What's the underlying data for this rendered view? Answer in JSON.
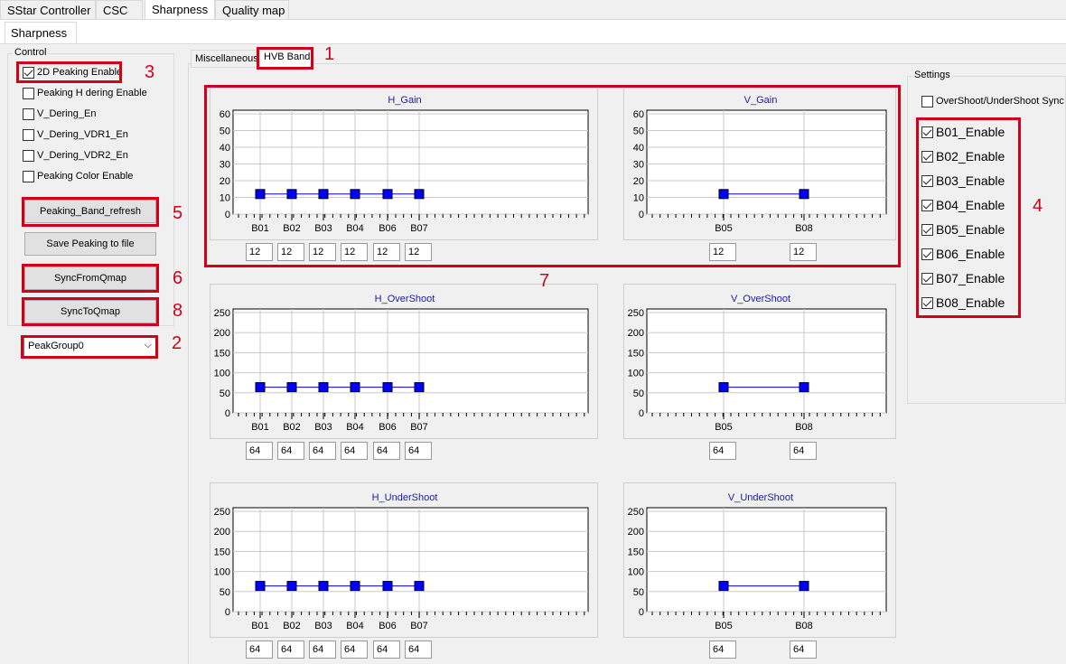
{
  "main_tabs": [
    "SStar Controller",
    "CSC",
    "Sharpness",
    "Quality map"
  ],
  "sub_tab": "Sharpness",
  "control": {
    "label": "Control",
    "checkboxes": [
      {
        "label": "2D Peaking Enable",
        "checked": true
      },
      {
        "label": "Peaking H dering Enable",
        "checked": false
      },
      {
        "label": "V_Dering_En",
        "checked": false
      },
      {
        "label": "V_Dering_VDR1_En",
        "checked": false
      },
      {
        "label": "V_Dering_VDR2_En",
        "checked": false
      },
      {
        "label": "Peaking Color Enable",
        "checked": false
      }
    ],
    "buttons": [
      "Peaking_Band_refresh",
      "Save Peaking to file",
      "SyncFromQmap",
      "SyncToQmap"
    ],
    "peak_group": "PeakGroup0"
  },
  "inner_tabs": [
    "Miscellaneous",
    "HVB Band"
  ],
  "settings": {
    "label": "Settings",
    "sync_label": "OverShoot/UnderShoot Sync",
    "bands": [
      {
        "label": "B01_Enable",
        "checked": true
      },
      {
        "label": "B02_Enable",
        "checked": true
      },
      {
        "label": "B03_Enable",
        "checked": true
      },
      {
        "label": "B04_Enable",
        "checked": true
      },
      {
        "label": "B05_Enable",
        "checked": true
      },
      {
        "label": "B06_Enable",
        "checked": true
      },
      {
        "label": "B07_Enable",
        "checked": true
      },
      {
        "label": "B08_Enable",
        "checked": true
      }
    ]
  },
  "annotations": [
    "1",
    "2",
    "3",
    "4",
    "5",
    "6",
    "7",
    "8"
  ],
  "chart_data": [
    {
      "type": "line",
      "title": "H_Gain",
      "categories": [
        "B01",
        "B02",
        "B03",
        "B04",
        "B06",
        "B07"
      ],
      "values": [
        12,
        12,
        12,
        12,
        12,
        12
      ],
      "ylim": [
        0,
        60
      ],
      "yticks": [
        "0",
        "10",
        "20",
        "30",
        "40",
        "50",
        "60"
      ]
    },
    {
      "type": "line",
      "title": "V_Gain",
      "categories": [
        "B05",
        "B08"
      ],
      "values": [
        12,
        12
      ],
      "ylim": [
        0,
        60
      ],
      "yticks": [
        "0",
        "10",
        "20",
        "30",
        "40",
        "50",
        "60"
      ]
    },
    {
      "type": "line",
      "title": "H_OverShoot",
      "categories": [
        "B01",
        "B02",
        "B03",
        "B04",
        "B06",
        "B07"
      ],
      "values": [
        64,
        64,
        64,
        64,
        64,
        64
      ],
      "ylim": [
        0,
        250
      ],
      "yticks": [
        "0",
        "50",
        "100",
        "150",
        "200",
        "250"
      ]
    },
    {
      "type": "line",
      "title": "V_OverShoot",
      "categories": [
        "B05",
        "B08"
      ],
      "values": [
        64,
        64
      ],
      "ylim": [
        0,
        250
      ],
      "yticks": [
        "0",
        "50",
        "100",
        "150",
        "200",
        "250"
      ]
    },
    {
      "type": "line",
      "title": "H_UnderShoot",
      "categories": [
        "B01",
        "B02",
        "B03",
        "B04",
        "B06",
        "B07"
      ],
      "values": [
        64,
        64,
        64,
        64,
        64,
        64
      ],
      "ylim": [
        0,
        250
      ],
      "yticks": [
        "0",
        "50",
        "100",
        "150",
        "200",
        "250"
      ]
    },
    {
      "type": "line",
      "title": "V_UnderShoot",
      "categories": [
        "B05",
        "B08"
      ],
      "values": [
        64,
        64
      ],
      "ylim": [
        0,
        250
      ],
      "yticks": [
        "0",
        "50",
        "100",
        "150",
        "200",
        "250"
      ]
    }
  ],
  "colors": {
    "marker": "#0000ff",
    "line": "#0000cc",
    "title": "#1a1aa6",
    "annotation": "#d0021b"
  }
}
